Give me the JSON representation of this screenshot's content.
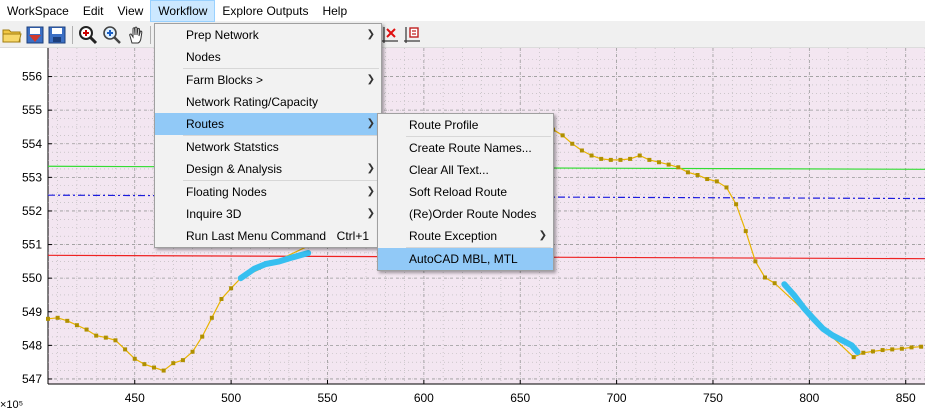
{
  "menubar": {
    "items": [
      {
        "label": "WorkSpace"
      },
      {
        "label": "Edit"
      },
      {
        "label": "View"
      },
      {
        "label": "Workflow"
      },
      {
        "label": "Explore Outputs"
      },
      {
        "label": "Help"
      }
    ],
    "active": "Workflow"
  },
  "workflow_menu": {
    "items": [
      {
        "label": "Prep Network",
        "submenu": true
      },
      {
        "label": "Nodes",
        "submenu": false
      },
      {
        "label": "Farm Blocks >",
        "submenu": true
      },
      {
        "label": "Network Rating/Capacity",
        "submenu": false
      },
      {
        "label": "Routes",
        "submenu": true,
        "selected": true
      },
      {
        "label": "Network Statstics",
        "submenu": false
      },
      {
        "label": "Design & Analysis",
        "submenu": true
      },
      {
        "label": "Floating Nodes",
        "submenu": true
      },
      {
        "label": "Inquire 3D",
        "submenu": true
      },
      {
        "label": "Run Last Menu Command",
        "submenu": false,
        "shortcut": "Ctrl+1"
      }
    ]
  },
  "routes_menu": {
    "items": [
      {
        "label": "Route Profile"
      },
      {
        "label": "Create Route Names..."
      },
      {
        "label": "Clear All Text..."
      },
      {
        "label": "Soft Reload Route"
      },
      {
        "label": "(Re)Order Route Nodes"
      },
      {
        "label": "Route Exception",
        "submenu": true
      },
      {
        "label": "AutoCAD MBL, MTL",
        "selected": true
      }
    ]
  },
  "toolbar": {
    "icons": [
      "open-folder-icon",
      "save-as-icon",
      "save-icon",
      "zoom-window-icon",
      "zoom-in-icon",
      "pan-hand-icon",
      "delete-node-icon",
      "insert-node-icon"
    ]
  },
  "chart_data": {
    "type": "line",
    "x_ticks": [
      "450",
      "500",
      "550",
      "600",
      "650",
      "700",
      "750",
      "800",
      "850"
    ],
    "y_ticks": [
      "547",
      "548",
      "549",
      "550",
      "551",
      "552",
      "553",
      "554",
      "555",
      "556"
    ],
    "x_exponent_label": "×10⁵",
    "xlim": [
      405,
      860
    ],
    "ylim": [
      546.85,
      556.85
    ],
    "grid": true,
    "colors": {
      "background": "#f3e6f1",
      "grid": "#b4b4b4",
      "profile": "#e8b400",
      "highlight": "#36bff0",
      "green_line": "#33dd33",
      "red_line": "#ee2222",
      "blue_dashdot": "#1c1cdd"
    },
    "reference_lines": [
      {
        "color": "green",
        "y": [
          553.33,
          553.24
        ]
      },
      {
        "color": "blue",
        "style": "dashdot",
        "y": [
          552.47,
          552.37
        ]
      },
      {
        "color": "red",
        "y": [
          550.68,
          550.58
        ]
      }
    ],
    "series": [
      {
        "kind": "profile",
        "points": [
          [
            405,
            548.79
          ],
          [
            410,
            548.82
          ],
          [
            415,
            548.73
          ],
          [
            420,
            548.6
          ],
          [
            425,
            548.47
          ],
          [
            430,
            548.29
          ],
          [
            435,
            548.23
          ],
          [
            440,
            548.15
          ],
          [
            445,
            547.88
          ],
          [
            450,
            547.6
          ],
          [
            455,
            547.44
          ],
          [
            460,
            547.34
          ],
          [
            465,
            547.25
          ],
          [
            470,
            547.47
          ],
          [
            475,
            547.56
          ],
          [
            480,
            547.81
          ],
          [
            485,
            548.26
          ],
          [
            490,
            548.82
          ],
          [
            495,
            549.38
          ],
          [
            500,
            549.7
          ],
          [
            505,
            550.0
          ],
          [
            662,
            554.3
          ],
          [
            667,
            554.42
          ],
          [
            672,
            554.25
          ],
          [
            677,
            554.0
          ],
          [
            682,
            553.8
          ],
          [
            687,
            553.65
          ],
          [
            692,
            553.55
          ],
          [
            697,
            553.52
          ],
          [
            702,
            553.52
          ],
          [
            707,
            553.55
          ],
          [
            712,
            553.65
          ],
          [
            717,
            553.52
          ],
          [
            722,
            553.45
          ],
          [
            727,
            553.38
          ],
          [
            732,
            553.3
          ],
          [
            737,
            553.15
          ],
          [
            742,
            553.07
          ],
          [
            747,
            552.95
          ],
          [
            752,
            552.88
          ],
          [
            757,
            552.7
          ],
          [
            762,
            552.2
          ],
          [
            767,
            551.4
          ],
          [
            772,
            550.5
          ],
          [
            777,
            550.02
          ],
          [
            782,
            549.85
          ],
          [
            823,
            547.65
          ],
          [
            828,
            547.78
          ],
          [
            833,
            547.82
          ],
          [
            838,
            547.86
          ],
          [
            843,
            547.88
          ],
          [
            848,
            547.9
          ],
          [
            853,
            547.94
          ],
          [
            858,
            547.96
          ]
        ]
      },
      {
        "kind": "highlight",
        "points": [
          [
            505,
            550.0
          ],
          [
            512,
            550.28
          ],
          [
            518,
            550.42
          ],
          [
            525,
            550.5
          ],
          [
            532,
            550.62
          ],
          [
            540,
            550.75
          ]
        ]
      },
      {
        "kind": "highlight",
        "points": [
          [
            787,
            549.82
          ],
          [
            792,
            549.5
          ],
          [
            797,
            549.12
          ],
          [
            802,
            548.8
          ],
          [
            807,
            548.5
          ],
          [
            812,
            548.3
          ],
          [
            817,
            548.15
          ],
          [
            822,
            548.0
          ],
          [
            825,
            547.8
          ]
        ]
      }
    ]
  }
}
